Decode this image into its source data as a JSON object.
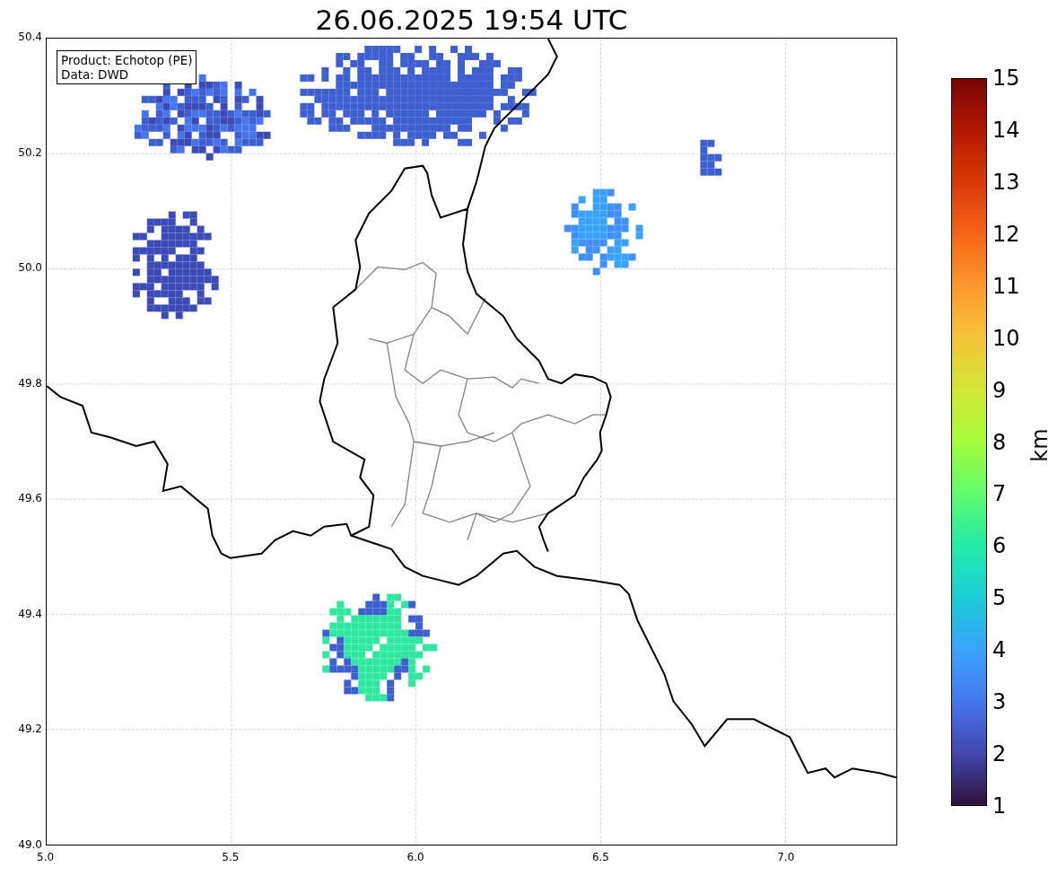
{
  "title": "26.06.2025 19:54 UTC",
  "legend": [
    "Product: Echotop (PE)",
    "Data: DWD"
  ],
  "map": {
    "x_ticks": [
      "5.0",
      "5.5",
      "6.0",
      "6.5",
      "7.0"
    ],
    "y_ticks": [
      "50.4",
      "50.2",
      "50.0",
      "49.8",
      "49.6",
      "49.4",
      "49.2",
      "49.0"
    ]
  },
  "colorbar": {
    "label": "km",
    "ticks": [
      "15",
      "14",
      "13",
      "12",
      "11",
      "10",
      "9",
      "8",
      "7",
      "6",
      "5",
      "4",
      "3",
      "2",
      "1"
    ]
  }
}
